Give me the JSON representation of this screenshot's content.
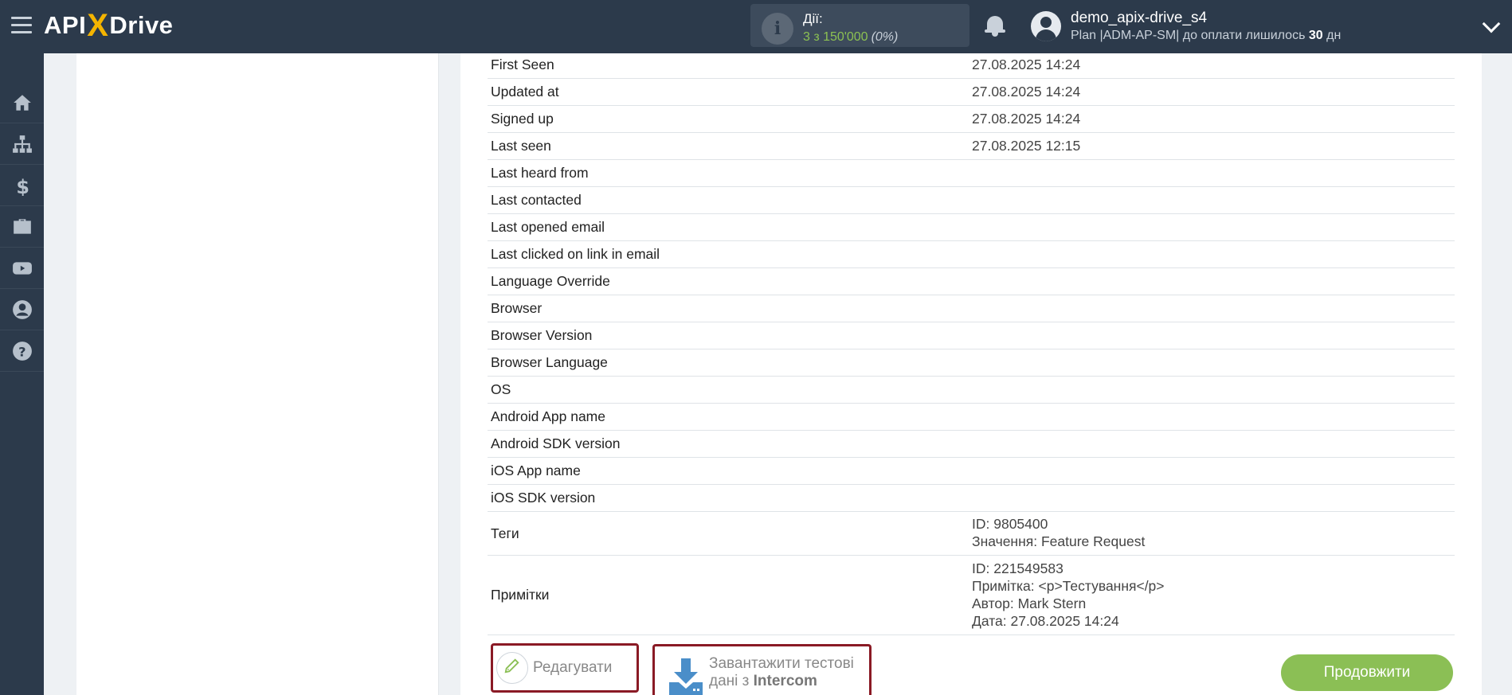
{
  "header": {
    "logo_api": "API",
    "logo_x": "X",
    "logo_drive": "Drive",
    "actions_label": "Дії:",
    "actions_value": "3 з 150'000",
    "actions_percent": "(0%)",
    "username": "demo_apix-drive_s4",
    "plan_prefix": "Plan |ADM-AP-SM| до оплати лишилось ",
    "plan_days": "30",
    "plan_suffix": " дн"
  },
  "sidebar": {
    "items": [
      "home-icon",
      "sitemap-icon",
      "dollar-icon",
      "briefcase-icon",
      "youtube-icon",
      "user-icon",
      "help-icon"
    ]
  },
  "rows": [
    {
      "key": "First Seen",
      "value": "27.08.2025 14:24"
    },
    {
      "key": "Updated at",
      "value": "27.08.2025 14:24"
    },
    {
      "key": "Signed up",
      "value": "27.08.2025 14:24"
    },
    {
      "key": "Last seen",
      "value": "27.08.2025 12:15"
    },
    {
      "key": "Last heard from",
      "value": ""
    },
    {
      "key": "Last contacted",
      "value": ""
    },
    {
      "key": "Last opened email",
      "value": ""
    },
    {
      "key": "Last clicked on link in email",
      "value": ""
    },
    {
      "key": "Language Override",
      "value": ""
    },
    {
      "key": "Browser",
      "value": ""
    },
    {
      "key": "Browser Version",
      "value": ""
    },
    {
      "key": "Browser Language",
      "value": ""
    },
    {
      "key": "OS",
      "value": ""
    },
    {
      "key": "Android App name",
      "value": ""
    },
    {
      "key": "Android SDK version",
      "value": ""
    },
    {
      "key": "iOS App name",
      "value": ""
    },
    {
      "key": "iOS SDK version",
      "value": ""
    }
  ],
  "tags": {
    "key": "Теги",
    "lines": [
      "ID: 9805400",
      "Значення: Feature Request"
    ]
  },
  "notes": {
    "key": "Примітки",
    "lines": [
      "ID: 221549583",
      "Примітка: <p>Тестування</p>",
      "Автор: Mark Stern",
      "Дата: 27.08.2025 14:24"
    ]
  },
  "buttons": {
    "edit": "Редагувати",
    "load_line1": "Завантажити тестові",
    "load_line2_prefix": "дані з ",
    "load_line2_bold": "Intercom",
    "continue": "Продовжити"
  },
  "colors": {
    "topbar": "#2c3a4b",
    "accent_green": "#8bbf55",
    "highlight_border": "#8a1a25",
    "logo_x": "#f4b400"
  }
}
